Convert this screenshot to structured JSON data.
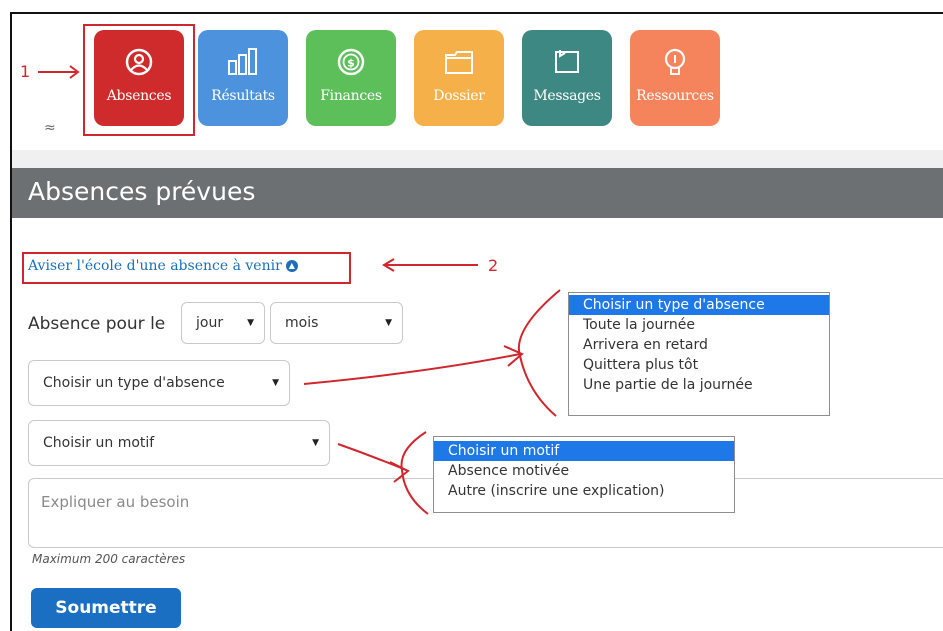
{
  "tiles": [
    {
      "label": "Absences",
      "color": "#cf2a2c",
      "icon": "person-circle-icon"
    },
    {
      "label": "Résultats",
      "color": "#4d92dc",
      "icon": "bar-chart-icon"
    },
    {
      "label": "Finances",
      "color": "#5cbf5a",
      "icon": "dollar-coin-icon"
    },
    {
      "label": "Dossier",
      "color": "#f5b049",
      "icon": "folder-icon"
    },
    {
      "label": "Messages",
      "color": "#3e8883",
      "icon": "message-note-icon"
    },
    {
      "label": "Ressources",
      "color": "#f5835b",
      "icon": "resources-icon"
    }
  ],
  "annotations": {
    "one": "1",
    "two": "2"
  },
  "collapse_glyph": "≈",
  "section": {
    "title": "Absences prévues"
  },
  "notify": {
    "link": "Aviser l'école d'une absence à venir"
  },
  "form": {
    "absence_pour_label": "Absence pour le",
    "day_select": "jour",
    "month_select": "mois",
    "type_select": "Choisir un type d'absence",
    "motif_select": "Choisir un motif",
    "explain_placeholder": "Expliquer au besoin",
    "max_chars": "Maximum 200 caractères",
    "submit_label": "Soumettre"
  },
  "type_options": [
    "Choisir un type d'absence",
    "Toute la journée",
    "Arrivera en retard",
    "Quittera plus tôt",
    "Une partie de la journée"
  ],
  "motif_options": [
    "Choisir un motif",
    "Absence motivée",
    "Autre (inscrire une explication)"
  ],
  "colors": {
    "accent": "#1a6fc2",
    "annotation_red": "#d0262e",
    "header_gray": "#6d7073",
    "selected_option": "#1e78e8"
  }
}
